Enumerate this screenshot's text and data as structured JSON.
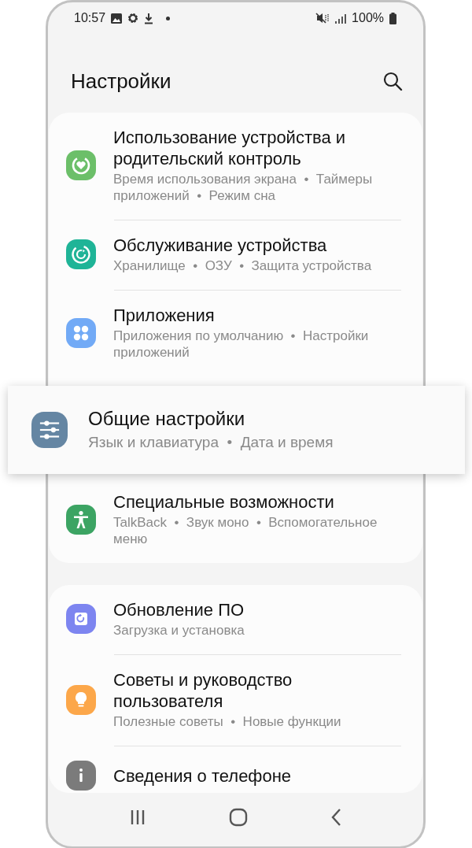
{
  "status_bar": {
    "time": "10:57",
    "battery": "100%"
  },
  "header": {
    "title": "Настройки"
  },
  "groups": [
    {
      "items": [
        {
          "title": "Использование устройства и родительский контроль",
          "subtitle": "Время использования экрана  •  Таймеры приложений  •  Режим сна",
          "color": "#6cbf69",
          "highlighted": false
        },
        {
          "title": "Обслуживание устройства",
          "subtitle": "Хранилище  •  ОЗУ  •  Защита устройства",
          "color": "#1fb497",
          "highlighted": false
        },
        {
          "title": "Приложения",
          "subtitle": "Приложения по умолчанию  •  Настройки приложений",
          "color": "#72aaf6",
          "highlighted": false
        },
        {
          "title": "Общие настройки",
          "subtitle": "Язык и клавиатура  •  Дата и время",
          "color": "#6586a3",
          "highlighted": true
        },
        {
          "title": "Специальные возможности",
          "subtitle": "TalkBack  •  Звук моно  •  Вспомогательное меню",
          "color": "#3ca463",
          "highlighted": false
        }
      ]
    },
    {
      "items": [
        {
          "title": "Обновление ПО",
          "subtitle": "Загрузка и установка",
          "color": "#7d85f0",
          "highlighted": false
        },
        {
          "title": "Советы и руководство пользователя",
          "subtitle": "Полезные советы  •  Новые функции",
          "color": "#fca74a",
          "highlighted": false
        },
        {
          "title": "Сведения о телефоне",
          "color": "#7b7b7b",
          "highlighted": false
        }
      ]
    }
  ]
}
